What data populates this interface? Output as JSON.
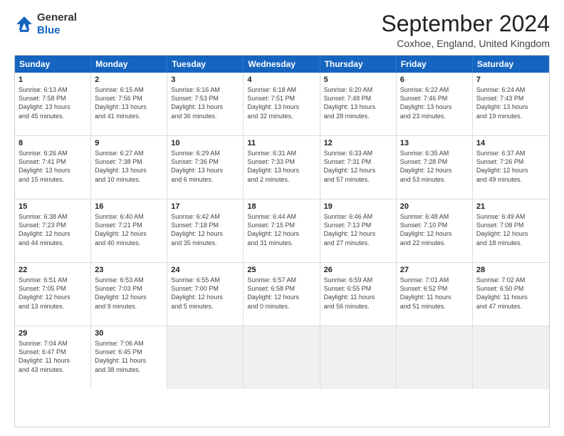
{
  "logo": {
    "line1": "General",
    "line2": "Blue"
  },
  "title": "September 2024",
  "location": "Coxhoe, England, United Kingdom",
  "weekdays": [
    "Sunday",
    "Monday",
    "Tuesday",
    "Wednesday",
    "Thursday",
    "Friday",
    "Saturday"
  ],
  "rows": [
    [
      {
        "day": "1",
        "lines": [
          "Sunrise: 6:13 AM",
          "Sunset: 7:58 PM",
          "Daylight: 13 hours",
          "and 45 minutes."
        ]
      },
      {
        "day": "2",
        "lines": [
          "Sunrise: 6:15 AM",
          "Sunset: 7:56 PM",
          "Daylight: 13 hours",
          "and 41 minutes."
        ]
      },
      {
        "day": "3",
        "lines": [
          "Sunrise: 6:16 AM",
          "Sunset: 7:53 PM",
          "Daylight: 13 hours",
          "and 36 minutes."
        ]
      },
      {
        "day": "4",
        "lines": [
          "Sunrise: 6:18 AM",
          "Sunset: 7:51 PM",
          "Daylight: 13 hours",
          "and 32 minutes."
        ]
      },
      {
        "day": "5",
        "lines": [
          "Sunrise: 6:20 AM",
          "Sunset: 7:48 PM",
          "Daylight: 13 hours",
          "and 28 minutes."
        ]
      },
      {
        "day": "6",
        "lines": [
          "Sunrise: 6:22 AM",
          "Sunset: 7:46 PM",
          "Daylight: 13 hours",
          "and 23 minutes."
        ]
      },
      {
        "day": "7",
        "lines": [
          "Sunrise: 6:24 AM",
          "Sunset: 7:43 PM",
          "Daylight: 13 hours",
          "and 19 minutes."
        ]
      }
    ],
    [
      {
        "day": "8",
        "lines": [
          "Sunrise: 6:26 AM",
          "Sunset: 7:41 PM",
          "Daylight: 13 hours",
          "and 15 minutes."
        ]
      },
      {
        "day": "9",
        "lines": [
          "Sunrise: 6:27 AM",
          "Sunset: 7:38 PM",
          "Daylight: 13 hours",
          "and 10 minutes."
        ]
      },
      {
        "day": "10",
        "lines": [
          "Sunrise: 6:29 AM",
          "Sunset: 7:36 PM",
          "Daylight: 13 hours",
          "and 6 minutes."
        ]
      },
      {
        "day": "11",
        "lines": [
          "Sunrise: 6:31 AM",
          "Sunset: 7:33 PM",
          "Daylight: 13 hours",
          "and 2 minutes."
        ]
      },
      {
        "day": "12",
        "lines": [
          "Sunrise: 6:33 AM",
          "Sunset: 7:31 PM",
          "Daylight: 12 hours",
          "and 57 minutes."
        ]
      },
      {
        "day": "13",
        "lines": [
          "Sunrise: 6:35 AM",
          "Sunset: 7:28 PM",
          "Daylight: 12 hours",
          "and 53 minutes."
        ]
      },
      {
        "day": "14",
        "lines": [
          "Sunrise: 6:37 AM",
          "Sunset: 7:26 PM",
          "Daylight: 12 hours",
          "and 49 minutes."
        ]
      }
    ],
    [
      {
        "day": "15",
        "lines": [
          "Sunrise: 6:38 AM",
          "Sunset: 7:23 PM",
          "Daylight: 12 hours",
          "and 44 minutes."
        ]
      },
      {
        "day": "16",
        "lines": [
          "Sunrise: 6:40 AM",
          "Sunset: 7:21 PM",
          "Daylight: 12 hours",
          "and 40 minutes."
        ]
      },
      {
        "day": "17",
        "lines": [
          "Sunrise: 6:42 AM",
          "Sunset: 7:18 PM",
          "Daylight: 12 hours",
          "and 35 minutes."
        ]
      },
      {
        "day": "18",
        "lines": [
          "Sunrise: 6:44 AM",
          "Sunset: 7:15 PM",
          "Daylight: 12 hours",
          "and 31 minutes."
        ]
      },
      {
        "day": "19",
        "lines": [
          "Sunrise: 6:46 AM",
          "Sunset: 7:13 PM",
          "Daylight: 12 hours",
          "and 27 minutes."
        ]
      },
      {
        "day": "20",
        "lines": [
          "Sunrise: 6:48 AM",
          "Sunset: 7:10 PM",
          "Daylight: 12 hours",
          "and 22 minutes."
        ]
      },
      {
        "day": "21",
        "lines": [
          "Sunrise: 6:49 AM",
          "Sunset: 7:08 PM",
          "Daylight: 12 hours",
          "and 18 minutes."
        ]
      }
    ],
    [
      {
        "day": "22",
        "lines": [
          "Sunrise: 6:51 AM",
          "Sunset: 7:05 PM",
          "Daylight: 12 hours",
          "and 13 minutes."
        ]
      },
      {
        "day": "23",
        "lines": [
          "Sunrise: 6:53 AM",
          "Sunset: 7:03 PM",
          "Daylight: 12 hours",
          "and 9 minutes."
        ]
      },
      {
        "day": "24",
        "lines": [
          "Sunrise: 6:55 AM",
          "Sunset: 7:00 PM",
          "Daylight: 12 hours",
          "and 5 minutes."
        ]
      },
      {
        "day": "25",
        "lines": [
          "Sunrise: 6:57 AM",
          "Sunset: 6:58 PM",
          "Daylight: 12 hours",
          "and 0 minutes."
        ]
      },
      {
        "day": "26",
        "lines": [
          "Sunrise: 6:59 AM",
          "Sunset: 6:55 PM",
          "Daylight: 11 hours",
          "and 56 minutes."
        ]
      },
      {
        "day": "27",
        "lines": [
          "Sunrise: 7:01 AM",
          "Sunset: 6:52 PM",
          "Daylight: 11 hours",
          "and 51 minutes."
        ]
      },
      {
        "day": "28",
        "lines": [
          "Sunrise: 7:02 AM",
          "Sunset: 6:50 PM",
          "Daylight: 11 hours",
          "and 47 minutes."
        ]
      }
    ],
    [
      {
        "day": "29",
        "lines": [
          "Sunrise: 7:04 AM",
          "Sunset: 6:47 PM",
          "Daylight: 11 hours",
          "and 43 minutes."
        ]
      },
      {
        "day": "30",
        "lines": [
          "Sunrise: 7:06 AM",
          "Sunset: 6:45 PM",
          "Daylight: 11 hours",
          "and 38 minutes."
        ]
      },
      {
        "day": "",
        "lines": []
      },
      {
        "day": "",
        "lines": []
      },
      {
        "day": "",
        "lines": []
      },
      {
        "day": "",
        "lines": []
      },
      {
        "day": "",
        "lines": []
      }
    ]
  ]
}
